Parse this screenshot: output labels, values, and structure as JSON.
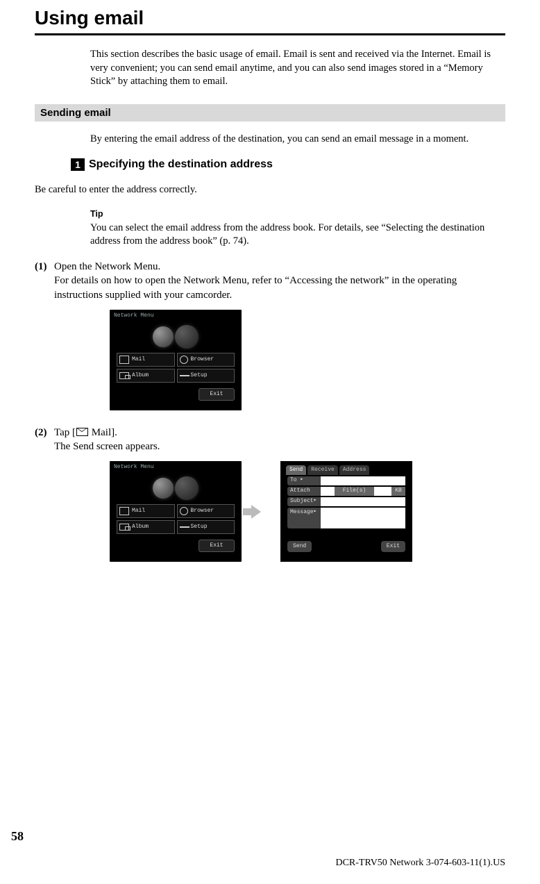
{
  "title": "Using email",
  "intro": "This section describes the basic usage of email. Email is sent and received via the Internet. Email is very convenient; you can send email anytime, and you can also send images stored in a “Memory Stick” by attaching them to email.",
  "section_heading": "Sending email",
  "section_intro": "By entering the email address of the destination, you can send an email message in a moment.",
  "sub_number": "1",
  "sub_heading": "Specifying the destination address",
  "careful_text": "Be careful to enter the address correctly.",
  "tip_label": "Tip",
  "tip_text": "You can select the email address from the address book. For details, see “Selecting the destination address from the address book” (p. 74).",
  "step1_num": "(1)",
  "step1_a": "Open the Network Menu.",
  "step1_b": "For details on how to open the Network Menu, refer to “Accessing the network” in the operating instructions supplied with your camcorder.",
  "step2_num": "(2)",
  "step2_a_before": "Tap [",
  "step2_a_after": " Mail].",
  "step2_b": "The Send screen appears.",
  "menu": {
    "title": "Network Menu",
    "mail": "Mail",
    "browser": "Browser",
    "album": "Album",
    "setup": "Setup",
    "exit": "Exit"
  },
  "send_screen": {
    "tab_send": "Send",
    "tab_receive": "Receive",
    "tab_address": "Address",
    "to": "To",
    "attach": "Attach",
    "files": "File(s)",
    "kb": "KB",
    "subject": "Subject",
    "message": "Message",
    "send_btn": "Send",
    "exit_btn": "Exit"
  },
  "page_number": "58",
  "footer": "DCR-TRV50 Network 3-074-603-11(1).US"
}
